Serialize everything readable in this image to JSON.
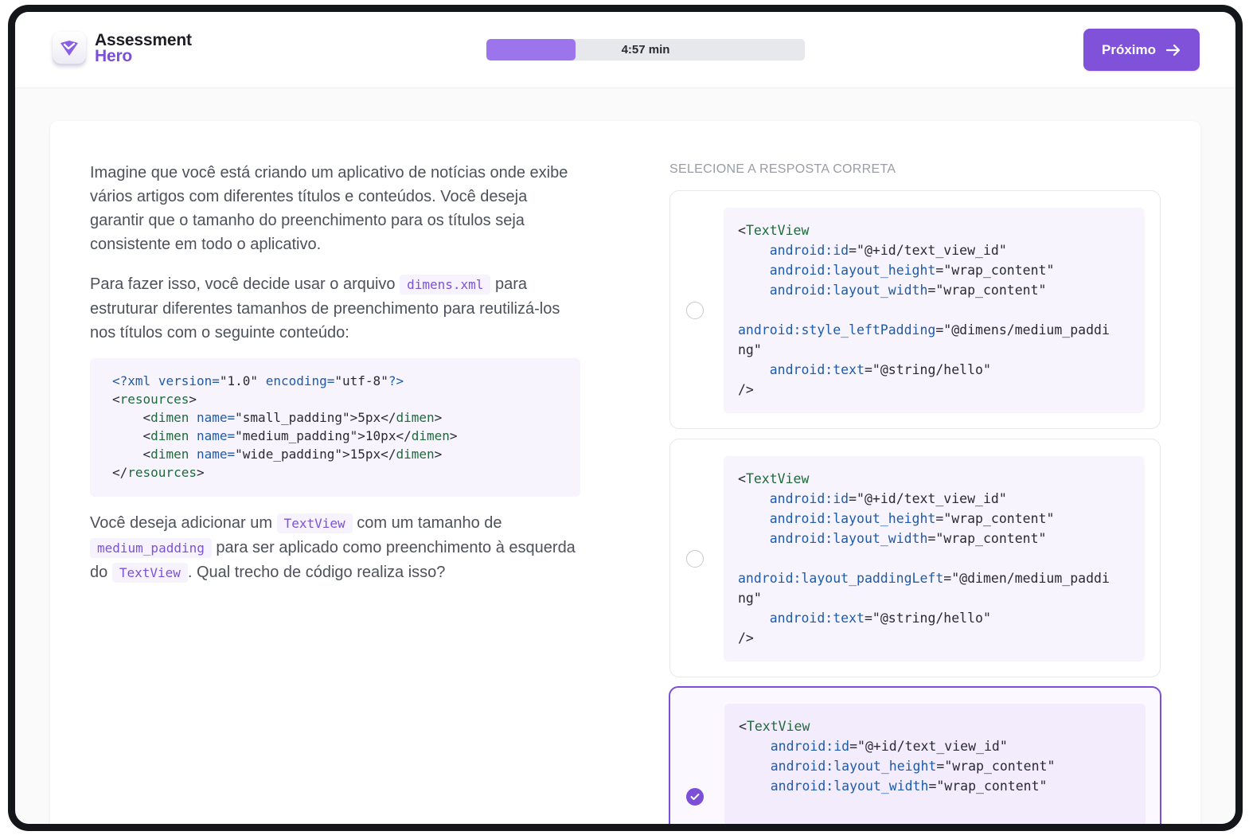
{
  "header": {
    "logo_line1": "Assessment",
    "logo_line2": "Hero",
    "timer_label": "4:57 min",
    "progress_fraction": 0.28,
    "next_label": "Próximo"
  },
  "question": {
    "p1": "Imagine que você está criando um aplicativo de notícias onde exibe vários artigos com diferentes títulos e conteúdos. Você deseja garantir que o tamanho do preenchimento para os títulos seja consistente em todo o aplicativo.",
    "p2_before": "Para fazer isso, você decide usar o arquivo",
    "p2_code": "dimens.xml",
    "p2_after": "para estruturar diferentes tamanhos de preenchimento para reutilizá-los nos títulos com o seguinte conteúdo:",
    "code_lines": {
      "l1_pi_open": "<?xml",
      "l1_attr1": "version=",
      "l1_val1": "\"1.0\"",
      "l1_attr2": "encoding=",
      "l1_val2": "\"utf-8\"",
      "l1_pi_close": "?>",
      "resources": "resources",
      "dimen": "dimen",
      "name_attr": "name=",
      "small_name": "\"small_padding\"",
      "small_value": ">5px</",
      "medium_name": "\"medium_padding\"",
      "medium_value": ">10px</",
      "wide_name": "\"wide_padding\"",
      "wide_value": ">15px</"
    },
    "p3_a": "Você deseja adicionar um",
    "p3_code1": "TextView",
    "p3_b": "com um tamanho de",
    "p3_code2": "medium_padding",
    "p3_c": "para ser aplicado como preenchimento à esquerda do",
    "p3_code3": "TextView",
    "p3_d": ". Qual trecho de código realiza isso?"
  },
  "answers": {
    "label": "SELECIONE A RESPOSTA CORRETA",
    "tag": "TextView",
    "id_attr": "android:id",
    "id_val": "\"@+id/text_view_id\"",
    "height_attr": "android:layout_height",
    "height_val": "\"wrap_content\"",
    "width_attr": "android:layout_width",
    "width_val": "\"wrap_content\"",
    "text_attr": "android:text",
    "text_val": "\"@string/hello\"",
    "close": "/>",
    "options": [
      {
        "padding_attr": "android:style_leftPadding",
        "padding_val_1": "\"@dimens/medium_paddi",
        "padding_val_2": "ng\"",
        "selected": false
      },
      {
        "padding_attr": "android:layout_paddingLeft",
        "padding_val_1": "\"@dimen/medium_paddi",
        "padding_val_2": "ng\"",
        "selected": false
      },
      {
        "selected": true
      }
    ]
  },
  "colors": {
    "accent": "#7b4fd8",
    "button": "#7f52d9",
    "progress_fill": "#9c74ec",
    "code_bg": "#f7f4fe",
    "xml_tag": "#1f6a3a",
    "xml_attr": "#1f5ba8"
  }
}
